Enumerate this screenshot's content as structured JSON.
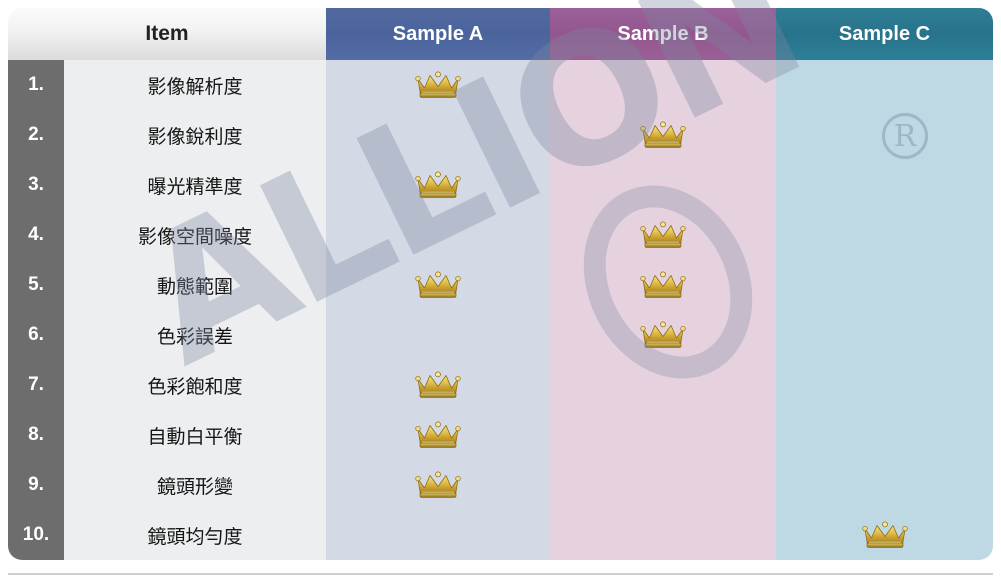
{
  "table": {
    "headers": {
      "item": "Item",
      "sample_a": "Sample A",
      "sample_b": "Sample B",
      "sample_c": "Sample C"
    },
    "header_colors": {
      "item": "#f2f2f2",
      "sample_a": "#4b649c",
      "sample_b": "#93578f",
      "sample_c": "#27738b"
    },
    "body_colors": {
      "number": "#6d6d6d",
      "item": "#eceef0",
      "sample_a": "#d4d9e6",
      "sample_b": "#e5d2de",
      "sample_c": "#bfd9e4"
    },
    "award_icon": "crown-icon",
    "rows": [
      {
        "number": "1.",
        "item": "影像解析度",
        "sample_a": true,
        "sample_b": false,
        "sample_c": false
      },
      {
        "number": "2.",
        "item": "影像銳利度",
        "sample_a": false,
        "sample_b": true,
        "sample_c": false
      },
      {
        "number": "3.",
        "item": "曝光精準度",
        "sample_a": true,
        "sample_b": false,
        "sample_c": false
      },
      {
        "number": "4.",
        "item": "影像空間噪度",
        "sample_a": false,
        "sample_b": true,
        "sample_c": false
      },
      {
        "number": "5.",
        "item": "動態範圍",
        "sample_a": true,
        "sample_b": true,
        "sample_c": false
      },
      {
        "number": "6.",
        "item": "色彩誤差",
        "sample_a": false,
        "sample_b": true,
        "sample_c": false
      },
      {
        "number": "7.",
        "item": "色彩飽和度",
        "sample_a": true,
        "sample_b": false,
        "sample_c": false
      },
      {
        "number": "8.",
        "item": "自動白平衡",
        "sample_a": true,
        "sample_b": false,
        "sample_c": false
      },
      {
        "number": "9.",
        "item": "鏡頭形變",
        "sample_a": true,
        "sample_b": false,
        "sample_c": false
      },
      {
        "number": "10.",
        "item": "鏡頭均勻度",
        "sample_a": false,
        "sample_b": false,
        "sample_c": true
      }
    ]
  },
  "watermark": {
    "text": "ALLION",
    "registered_mark": "R",
    "color": "#7b889f"
  }
}
